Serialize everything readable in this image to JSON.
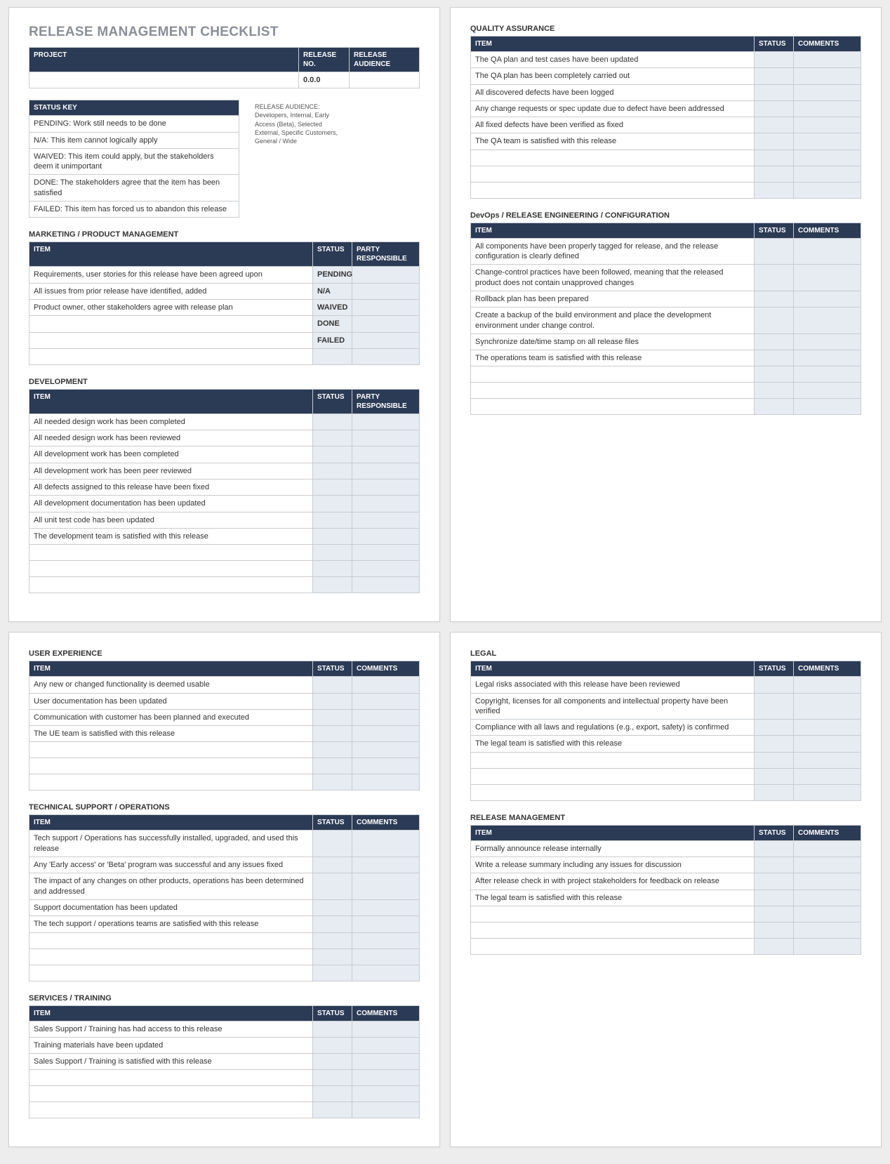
{
  "title": "RELEASE MANAGEMENT CHECKLIST",
  "projectTable": {
    "headers": [
      "PROJECT",
      "RELEASE NO.",
      "RELEASE AUDIENCE"
    ],
    "releaseNo": "0.0.0"
  },
  "statusKey": {
    "header": "STATUS KEY",
    "rows": [
      "PENDING:  Work still needs to be done",
      "N/A:  This item cannot logically apply",
      "WAIVED:  This item could apply, but the stakeholders deem it unimportant",
      "DONE:  The stakeholders agree that the item has been satisfied",
      "FAILED:  This item has forced us to abandon this release"
    ]
  },
  "releaseAudienceNote": "RELEASE AUDIENCE:\nDevelopers, Internal, Early Access (Beta), Selected External, Specific Customers, General / Wide",
  "sections": {
    "marketing": {
      "title": "MARKETING / PRODUCT MANAGEMENT",
      "cols": [
        "ITEM",
        "STATUS",
        "PARTY RESPONSIBLE"
      ],
      "rows": [
        {
          "item": "Requirements, user stories for this release have been agreed upon",
          "status": "PENDING"
        },
        {
          "item": "All issues from prior release have identified, added",
          "status": "N/A"
        },
        {
          "item": "Product owner, other stakeholders agree with release plan",
          "status": "WAIVED"
        },
        {
          "item": "",
          "status": "DONE"
        },
        {
          "item": "",
          "status": "FAILED"
        },
        {
          "item": "",
          "status": ""
        }
      ]
    },
    "development": {
      "title": "DEVELOPMENT",
      "cols": [
        "ITEM",
        "STATUS",
        "PARTY RESPONSIBLE"
      ],
      "rows": [
        {
          "item": "All needed design work has been completed"
        },
        {
          "item": "All needed design work has been reviewed"
        },
        {
          "item": "All development work has been completed"
        },
        {
          "item": "All development work has been peer reviewed"
        },
        {
          "item": "All defects assigned to this release have been fixed"
        },
        {
          "item": "All development documentation has been updated"
        },
        {
          "item": "All unit test code has been updated"
        },
        {
          "item": "The development team is satisfied with this release"
        },
        {
          "item": ""
        },
        {
          "item": ""
        },
        {
          "item": ""
        }
      ]
    },
    "qa": {
      "title": "QUALITY ASSURANCE",
      "cols": [
        "ITEM",
        "STATUS",
        "COMMENTS"
      ],
      "rows": [
        {
          "item": "The QA plan and test cases have been updated"
        },
        {
          "item": "The QA plan has been completely carried out"
        },
        {
          "item": "All discovered defects have been logged"
        },
        {
          "item": "Any change requests or spec update due to defect have been addressed"
        },
        {
          "item": "All fixed defects have been verified as fixed"
        },
        {
          "item": "The QA team is satisfied with this release"
        },
        {
          "item": ""
        },
        {
          "item": ""
        },
        {
          "item": ""
        }
      ]
    },
    "devops": {
      "title": "DevOps / RELEASE ENGINEERING / CONFIGURATION",
      "cols": [
        "ITEM",
        "STATUS",
        "COMMENTS"
      ],
      "rows": [
        {
          "item": "All components have been properly tagged for release, and the release configuration is clearly defined"
        },
        {
          "item": "Change-control practices have been followed, meaning that the released product does not contain unapproved changes"
        },
        {
          "item": "Rollback plan has been prepared"
        },
        {
          "item": "Create a backup of the build environment and place the development environment under change control."
        },
        {
          "item": "Synchronize date/time stamp on all release files"
        },
        {
          "item": "The operations team is satisfied with this release"
        },
        {
          "item": ""
        },
        {
          "item": ""
        },
        {
          "item": ""
        }
      ]
    },
    "ux": {
      "title": "USER EXPERIENCE",
      "cols": [
        "ITEM",
        "STATUS",
        "COMMENTS"
      ],
      "rows": [
        {
          "item": "Any new or changed functionality is deemed usable"
        },
        {
          "item": "User documentation has been updated"
        },
        {
          "item": "Communication with customer has been planned and executed"
        },
        {
          "item": "The UE team is satisfied with this release"
        },
        {
          "item": ""
        },
        {
          "item": ""
        },
        {
          "item": ""
        }
      ]
    },
    "techsupport": {
      "title": "TECHNICAL SUPPORT / OPERATIONS",
      "cols": [
        "ITEM",
        "STATUS",
        "COMMENTS"
      ],
      "rows": [
        {
          "item": "Tech support / Operations has successfully installed, upgraded, and used this release"
        },
        {
          "item": "Any 'Early access' or 'Beta' program was successful and any issues fixed"
        },
        {
          "item": "The impact of any changes on other products, operations has been determined and addressed"
        },
        {
          "item": "Support documentation has been updated"
        },
        {
          "item": "The tech support / operations teams are satisfied with this release"
        },
        {
          "item": ""
        },
        {
          "item": ""
        },
        {
          "item": ""
        }
      ]
    },
    "services": {
      "title": "SERVICES / TRAINING",
      "cols": [
        "ITEM",
        "STATUS",
        "COMMENTS"
      ],
      "rows": [
        {
          "item": "Sales Support / Training has had access to this release"
        },
        {
          "item": "Training materials have been updated"
        },
        {
          "item": "Sales Support / Training is satisfied with this release"
        },
        {
          "item": ""
        },
        {
          "item": ""
        },
        {
          "item": ""
        }
      ]
    },
    "legal": {
      "title": "LEGAL",
      "cols": [
        "ITEM",
        "STATUS",
        "COMMENTS"
      ],
      "rows": [
        {
          "item": "Legal risks associated with this release have been reviewed"
        },
        {
          "item": "Copyright, licenses for all components and intellectual property have been verified"
        },
        {
          "item": "Compliance with all laws and regulations (e.g., export, safety) is confirmed"
        },
        {
          "item": "The legal team is satisfied with this release"
        },
        {
          "item": ""
        },
        {
          "item": ""
        },
        {
          "item": ""
        }
      ]
    },
    "relmgmt": {
      "title": "RELEASE MANAGEMENT",
      "cols": [
        "ITEM",
        "STATUS",
        "COMMENTS"
      ],
      "rows": [
        {
          "item": "Formally announce release internally"
        },
        {
          "item": "Write a release summary including any issues for discussion"
        },
        {
          "item": "After release check in with project stakeholders for feedback on release"
        },
        {
          "item": "The legal team is satisfied with this release"
        },
        {
          "item": ""
        },
        {
          "item": ""
        },
        {
          "item": ""
        }
      ]
    }
  }
}
